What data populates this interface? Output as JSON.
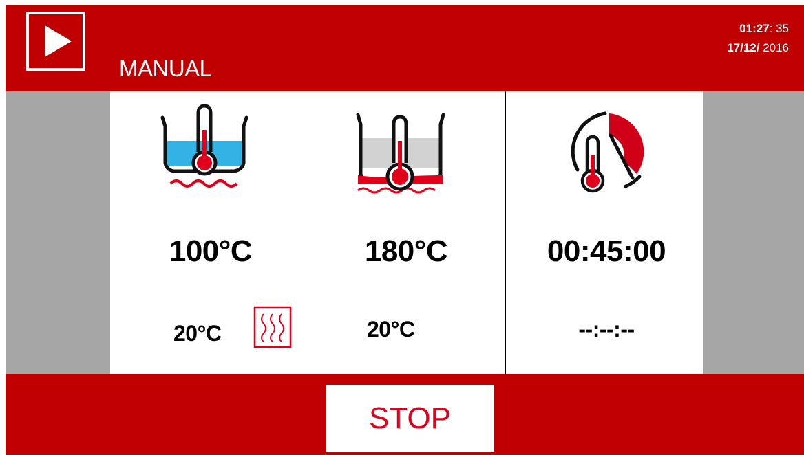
{
  "header": {
    "mode_label": "MANUAL",
    "time_hm": "01:27",
    "time_sec": ": 35",
    "date_dm": "17/12/",
    "date_year": " 2016",
    "play_icon": "play-icon"
  },
  "bath": {
    "icon": "water-bath-icon",
    "setpoint": "100°C",
    "current": "20°C",
    "heating_icon": "heating-icon"
  },
  "pan": {
    "icon": "pan-probe-icon",
    "setpoint": "180°C",
    "current": "20°C"
  },
  "timer": {
    "icon": "thermo-timer-icon",
    "setpoint": "00:45:00",
    "current": "--:--:--"
  },
  "footer": {
    "stop_label": "STOP"
  },
  "colors": {
    "brand_red": "#c00000",
    "water_blue": "#33b2e6",
    "gray_background": "#a6a6a6"
  }
}
